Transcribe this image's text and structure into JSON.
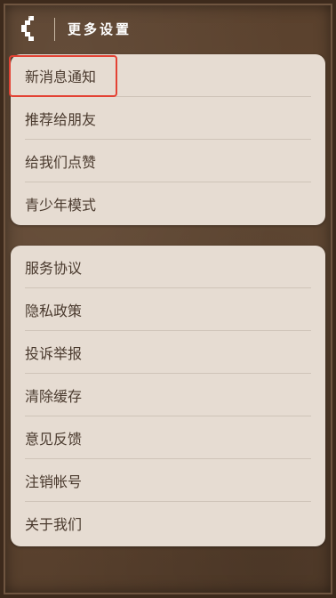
{
  "header": {
    "title": "更多设置",
    "back_icon": "back-chevron-icon"
  },
  "group1": {
    "items": [
      {
        "label": "新消息通知"
      },
      {
        "label": "推荐给朋友"
      },
      {
        "label": "给我们点赞"
      },
      {
        "label": "青少年模式"
      }
    ]
  },
  "group2": {
    "items": [
      {
        "label": "服务协议"
      },
      {
        "label": "隐私政策"
      },
      {
        "label": "投诉举报"
      },
      {
        "label": "清除缓存"
      },
      {
        "label": "意见反馈"
      },
      {
        "label": "注销帐号"
      },
      {
        "label": "关于我们"
      }
    ]
  },
  "colors": {
    "background": "#5b4330",
    "card": "#e6dcd2",
    "text": "#4a3a2e",
    "highlight": "#e34234"
  }
}
